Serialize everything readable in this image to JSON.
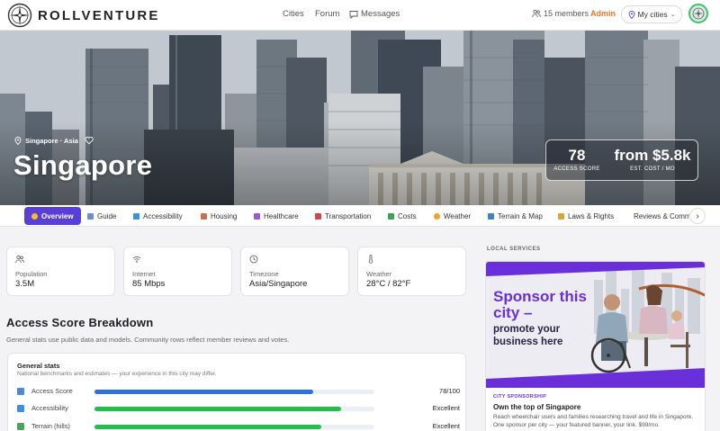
{
  "header": {
    "brand": "ROLLVENTURE",
    "nav": [
      {
        "label": "Cities"
      },
      {
        "label": "Forum"
      },
      {
        "label": "Messages"
      }
    ],
    "members": "15 members",
    "admin": "Admin",
    "my_cities": "My cities"
  },
  "hero": {
    "location": "Singapore · Asia",
    "city": "Singapore",
    "access_score": "78",
    "access_score_label": "ACCESS SCORE",
    "cost": "from $5.8k",
    "cost_label": "EST. COST / MO"
  },
  "tabs": [
    {
      "label": "Overview",
      "icon": "star-icon",
      "color": "#f2c21b"
    },
    {
      "label": "Guide",
      "icon": "book-icon",
      "color": "#6d8fc9"
    },
    {
      "label": "Accessibility",
      "icon": "wheelchair-icon",
      "color": "#3d8fe0"
    },
    {
      "label": "Housing",
      "icon": "house-icon",
      "color": "#c8704a"
    },
    {
      "label": "Healthcare",
      "icon": "hospital-icon",
      "color": "#9b5ad1"
    },
    {
      "label": "Transportation",
      "icon": "bus-icon",
      "color": "#d64545"
    },
    {
      "label": "Costs",
      "icon": "money-icon",
      "color": "#3aa35a"
    },
    {
      "label": "Weather",
      "icon": "sun-icon",
      "color": "#f0a030"
    },
    {
      "label": "Terrain & Map",
      "icon": "map-icon",
      "color": "#3f83c7"
    },
    {
      "label": "Laws & Rights",
      "icon": "scales-icon",
      "color": "#d9a43a"
    },
    {
      "label": "Reviews & Comm",
      "icon": "chat-icon",
      "color": "#b8b8c0"
    }
  ],
  "stats": [
    {
      "label": "Population",
      "value": "3.5M",
      "icon": "people-icon"
    },
    {
      "label": "Internet",
      "value": "85 Mbps",
      "icon": "wifi-icon"
    },
    {
      "label": "Timezone",
      "value": "Asia/Singapore",
      "icon": "clock-icon"
    },
    {
      "label": "Weather",
      "value": "28°C / 82°F",
      "icon": "thermometer-icon"
    }
  ],
  "breakdown": {
    "title": "Access Score Breakdown",
    "subtitle": "General stats use public data and models. Community rows reflect member reviews and votes.",
    "group_title": "General stats",
    "group_note": "National benchmarks and estimates — your experience in this city may differ.",
    "rows": [
      {
        "label": "Access Score",
        "value": "78/100",
        "fraction": 0.78,
        "color": "#2f6fe0",
        "icon_color": "#4a8ad8"
      },
      {
        "label": "Accessibility",
        "value": "Excellent",
        "fraction": 0.88,
        "color": "#1fc04c",
        "icon_color": "#3d8fe0"
      },
      {
        "label": "Terrain (hills)",
        "value": "Excellent",
        "fraction": 0.81,
        "color": "#1fc04c",
        "icon_color": "#4ba35a"
      }
    ]
  },
  "sidebar": {
    "section_label": "LOCAL SERVICES",
    "ad": {
      "headline": "Sponsor this city –",
      "subline": "promote your business here",
      "kicker": "CITY SPONSORSHIP",
      "title": "Own the top of Singapore",
      "description": "Reach wheelchair users and families researching travel and life in Singapore. One sponsor per city — your featured banner, your link. $99/mo."
    }
  }
}
